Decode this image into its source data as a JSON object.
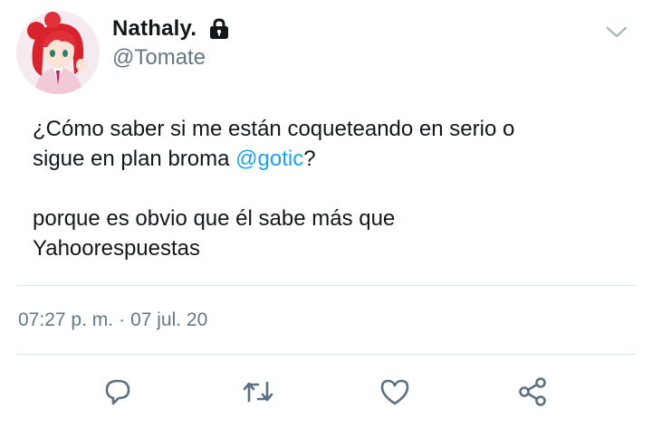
{
  "user": {
    "display_name": "Nathaly.",
    "handle": "@Tomate",
    "avatar": "avatar-anime-girl-red-hair",
    "protected_icon": "lock-icon"
  },
  "tweet": {
    "line1_part1": "¿Cómo saber si me están coqueteando en serio o",
    "line2_part1": "sigue en plan broma ",
    "mention": "@gotic",
    "line2_part2": "?",
    "paragraph2_line1": "porque es obvio que él sabe más que",
    "paragraph2_line2": "Yahoorespuestas"
  },
  "meta": {
    "time": "07:27 p. m.",
    "separator": "·",
    "date": "07 jul. 20"
  },
  "actions": [
    {
      "icon": "reply-icon"
    },
    {
      "icon": "retweet-icon"
    },
    {
      "icon": "like-icon"
    },
    {
      "icon": "share-icon"
    }
  ],
  "colors": {
    "accent": "#1da1f2",
    "text": "#14171a",
    "secondary": "#657786",
    "divider": "#e1e8ed",
    "icon": "#5b7083"
  }
}
